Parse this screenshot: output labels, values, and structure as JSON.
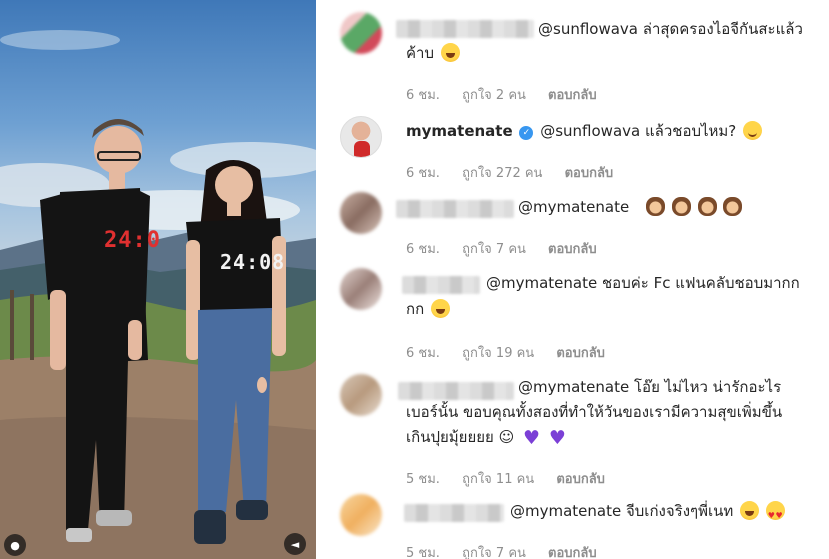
{
  "comments": [
    {
      "mention": "@sunflowava",
      "text_line1": "ล่าสุดครองไอจีกันสะแล้ว",
      "text_line2": "ค้าบ",
      "time": "6 ชม.",
      "likes": "ถูกใจ 2 คน",
      "reply": "ตอบกลับ"
    },
    {
      "username": "mymatenate",
      "verified": true,
      "mention": "@sunflowava",
      "text_line1": "แล้วชอบไหม?",
      "time": "6 ชม.",
      "likes": "ถูกใจ 272 คน",
      "reply": "ตอบกลับ"
    },
    {
      "mention": "@mymatenate",
      "text_line1": "",
      "time": "6 ชม.",
      "likes": "ถูกใจ 7 คน",
      "reply": "ตอบกลับ"
    },
    {
      "mention": "@mymatenate",
      "text_line1": "ชอบค่ะ Fc แฟนคลับชอบมากก",
      "text_line2": "กก",
      "time": "6 ชม.",
      "likes": "ถูกใจ 19 คน",
      "reply": "ตอบกลับ"
    },
    {
      "mention": "@mymatenate",
      "text_line1": "โอ๊ย ไม่ไหว น่ารักอะไร",
      "text_line2": "เบอร์นั้น ขอบคุณทั้งสองที่ทำให้วันของเรามีความสุขเพิ่มขึ้น",
      "text_line3": "เกินปุยมุ้ยยยย ☺",
      "time": "5 ชม.",
      "likes": "ถูกใจ 11 คน",
      "reply": "ตอบกลับ"
    },
    {
      "mention": "@mymatenate",
      "text_line1": "จีบเก่งจริงๆพี่เนท",
      "time": "5 ชม.",
      "likes": "ถูกใจ 7 คน",
      "reply": "ตอบกลับ"
    }
  ],
  "photo": {
    "shirt_text_left": "24:0",
    "shirt_text_right": "24:08"
  },
  "icons": {
    "profile": "person-icon",
    "sound": "speaker-icon"
  },
  "colors": {
    "text": "#262626",
    "meta": "#8e8e8e",
    "verified": "#3897f0",
    "heart": "#7b3fd6"
  }
}
